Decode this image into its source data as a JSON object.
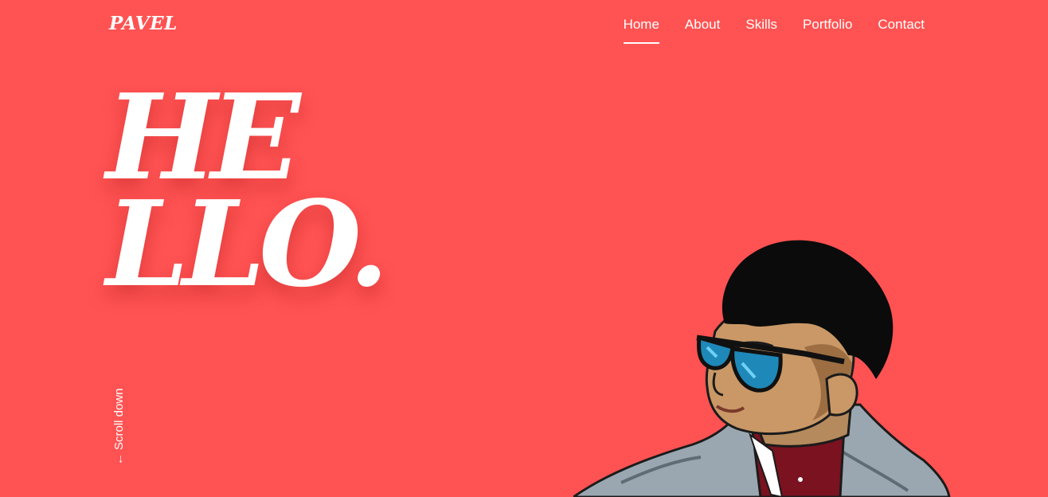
{
  "header": {
    "logo": "PAVEL",
    "nav": [
      {
        "label": "Home",
        "active": true
      },
      {
        "label": "About",
        "active": false
      },
      {
        "label": "Skills",
        "active": false
      },
      {
        "label": "Portfolio",
        "active": false
      },
      {
        "label": "Contact",
        "active": false
      }
    ]
  },
  "hero": {
    "line1": "HE",
    "line2": "LLO."
  },
  "scroll": {
    "label": "Scroll down",
    "icon": "arrow-down-icon"
  },
  "illustration": {
    "name": "portrait-illustration"
  },
  "colors": {
    "background": "#ff5252",
    "text": "#ffffff"
  }
}
